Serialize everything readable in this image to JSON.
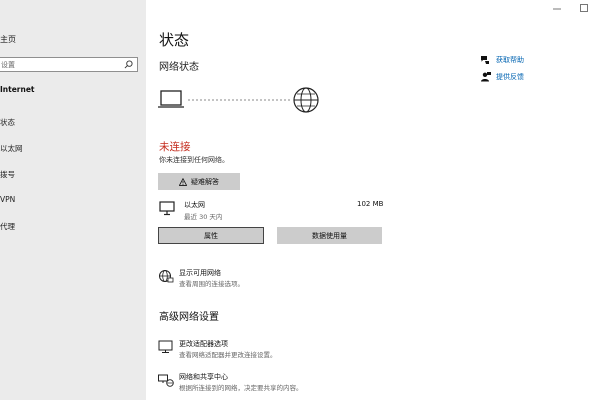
{
  "window": {
    "minimize_icon": "minimize-icon",
    "maximize_icon": "maximize-icon"
  },
  "sidebar": {
    "home": "主页",
    "search": {
      "value": "设置",
      "icon": "search-icon"
    },
    "section": "Internet",
    "items": [
      {
        "label": "状态"
      },
      {
        "label": "以太网"
      },
      {
        "label": "拨号"
      },
      {
        "label": "VPN"
      },
      {
        "label": "代理"
      }
    ]
  },
  "main": {
    "title": "状态",
    "network_status_heading": "网络状态",
    "status_text": "未连接",
    "status_desc": "你未连接到任何网络。",
    "troubleshoot_label": "疑难解答",
    "ethernet": {
      "name": "以太网",
      "last_time": "最近 30 天内",
      "data_size": "102 MB"
    },
    "properties_label": "属性",
    "data_usage_label": "数据使用量",
    "show_networks": {
      "title": "显示可用网络",
      "desc": "查看周围的连接选项。"
    },
    "advanced_heading": "高级网络设置",
    "adapter_options": {
      "title": "更改适配器选项",
      "desc": "查看网络适配器并更改连接设置。"
    },
    "sharing_center": {
      "title": "网络和共享中心",
      "desc": "根据所连接到的网络，决定要共享的内容。"
    }
  },
  "help": {
    "get_help": "获取帮助",
    "feedback": "提供反馈"
  },
  "colors": {
    "error": "#c42b1c",
    "link": "#0063b1",
    "sidebar_bg": "#ebebeb",
    "button_bg": "#cccccc"
  }
}
